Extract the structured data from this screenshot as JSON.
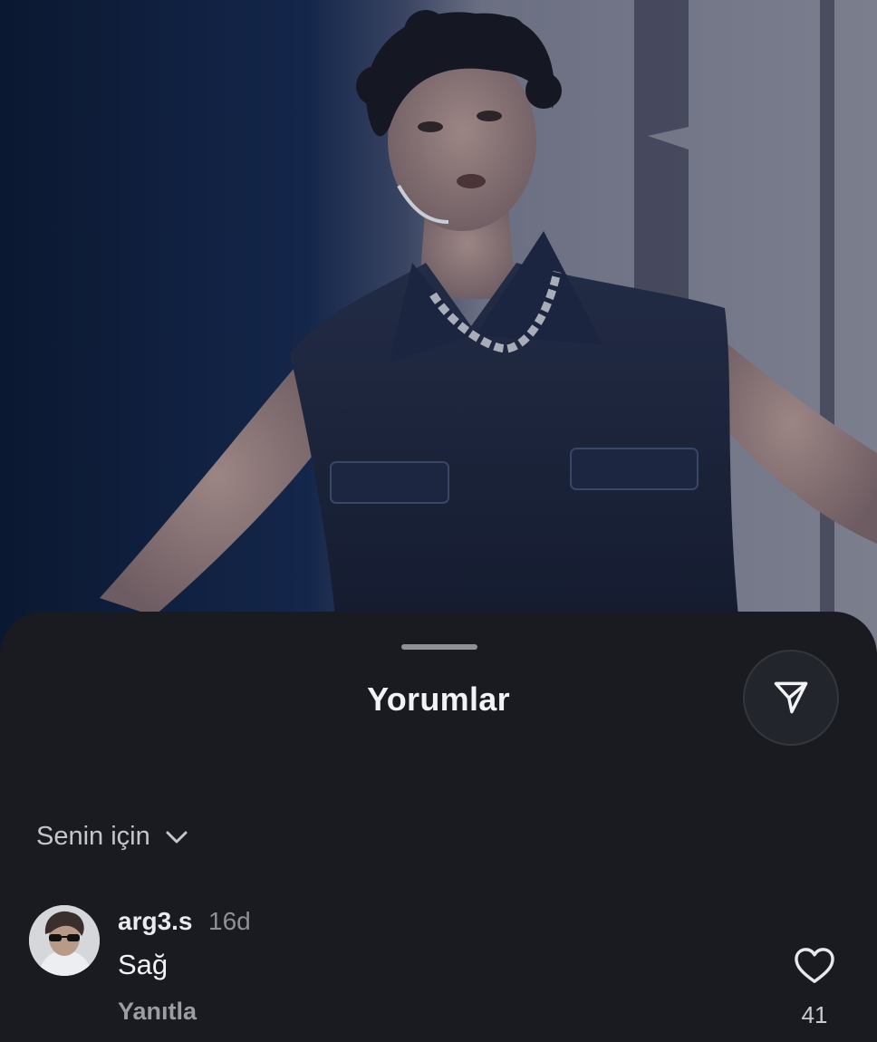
{
  "sheet": {
    "title": "Yorumlar",
    "share_icon": "send-icon"
  },
  "sort": {
    "label": "Senin için",
    "icon": "chevron-down-icon"
  },
  "comments": [
    {
      "username": "arg3.s",
      "time": "16d",
      "text": "Sağ",
      "reply_label": "Yanıtla",
      "likes": "41",
      "like_icon": "heart-icon"
    }
  ],
  "colors": {
    "sheet_background": "#191b20",
    "text_primary": "#f2f3f5",
    "text_secondary": "#8d9096"
  }
}
